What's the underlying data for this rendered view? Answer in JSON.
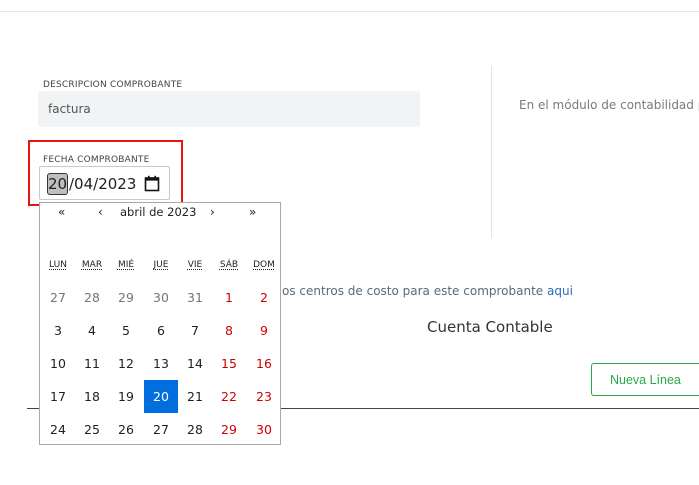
{
  "form": {
    "descripcion_label": "DESCRIPCION COMPROBANTE",
    "descripcion_value": "factura",
    "fecha_label": "FECHA COMPROBANTE",
    "fecha_day": "20",
    "fecha_rest": "/04/2023",
    "right_text": "En el módulo de contabilidad p"
  },
  "calendar": {
    "nav_first": "«",
    "nav_prev": "‹",
    "month_label": "abril de 2023",
    "nav_next": "›",
    "nav_last": "»",
    "weekdays": [
      "LUN",
      "MAR",
      "MIÉ",
      "JUE",
      "VIE",
      "SÁB",
      "DOM"
    ],
    "weeks": [
      [
        "27",
        "28",
        "29",
        "30",
        "31",
        "1",
        "2"
      ],
      [
        "3",
        "4",
        "5",
        "6",
        "7",
        "8",
        "9"
      ],
      [
        "10",
        "11",
        "12",
        "13",
        "14",
        "15",
        "16"
      ],
      [
        "17",
        "18",
        "19",
        "20",
        "21",
        "22",
        "23"
      ],
      [
        "24",
        "25",
        "26",
        "27",
        "28",
        "29",
        "30"
      ]
    ],
    "selected_day": "20",
    "weekend_color": "#d10000",
    "selected_color": "#006edc"
  },
  "cost_center": {
    "text": "os centros de costo para este comprobante",
    "link": "aqui"
  },
  "table": {
    "column_header": "Cuenta Contable",
    "new_line_button": "Nueva Línea"
  },
  "colors": {
    "highlight_border": "#e8140f",
    "button_green": "#27a844"
  }
}
